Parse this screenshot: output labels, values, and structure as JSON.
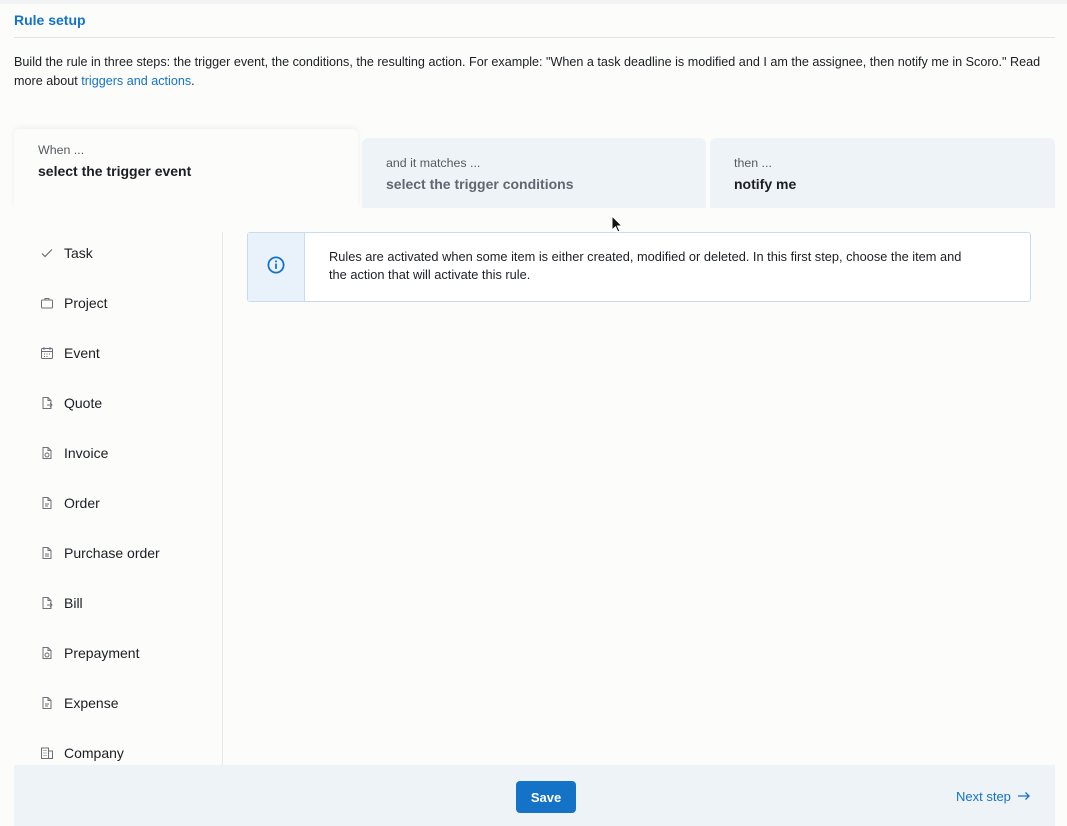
{
  "header": {
    "title": "Rule setup",
    "intro": "Build the rule in three steps: the trigger event, the conditions, the resulting action. For example: \"When a task deadline is modified and I am the assignee, then notify me in Scoro.\" Read more about ",
    "intro_link": "triggers and actions",
    "intro_end": "."
  },
  "steps": [
    {
      "pre": "When ...",
      "main": "select the trigger event"
    },
    {
      "pre": "and it matches ...",
      "main": "select the trigger conditions"
    },
    {
      "pre": "then ...",
      "main": "notify me"
    }
  ],
  "menu": {
    "items": [
      {
        "label": "Task",
        "icon": "check-icon"
      },
      {
        "label": "Project",
        "icon": "briefcase-icon"
      },
      {
        "label": "Event",
        "icon": "calendar-icon"
      },
      {
        "label": "Quote",
        "icon": "quote-document-icon"
      },
      {
        "label": "Invoice",
        "icon": "invoice-document-icon"
      },
      {
        "label": "Order",
        "icon": "order-document-icon"
      },
      {
        "label": "Purchase order",
        "icon": "purchase-order-icon"
      },
      {
        "label": "Bill",
        "icon": "bill-document-icon"
      },
      {
        "label": "Prepayment",
        "icon": "prepayment-document-icon"
      },
      {
        "label": "Expense",
        "icon": "expense-document-icon"
      },
      {
        "label": "Company",
        "icon": "building-icon"
      }
    ]
  },
  "info": {
    "icon": "info-icon",
    "text": "Rules are activated when some item is either created, modified or deleted. In this first step, choose the item and the action that will activate this rule."
  },
  "footer": {
    "save_label": "Save",
    "next_label": "Next step"
  },
  "colors": {
    "accent": "#1473c7",
    "step_inactive_bg": "#eef3f8",
    "info_bg": "#e9f2fa"
  }
}
